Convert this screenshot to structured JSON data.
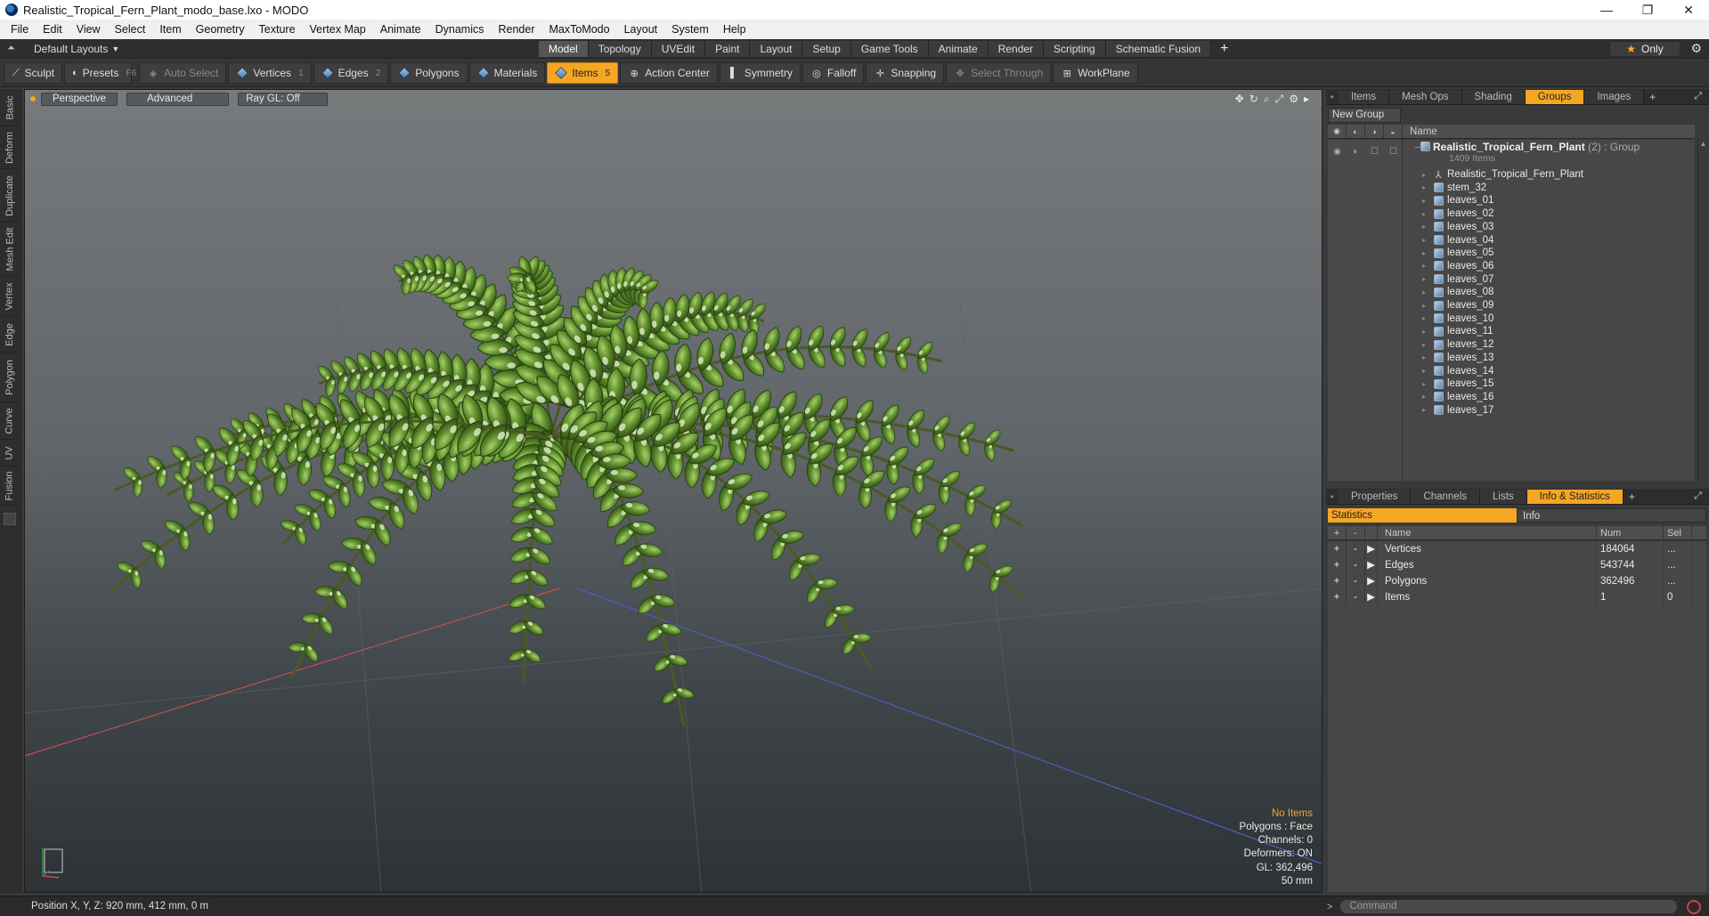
{
  "window": {
    "title": "Realistic_Tropical_Fern_Plant_modo_base.lxo - MODO",
    "controls": [
      "—",
      "❐",
      "✕"
    ]
  },
  "menu": [
    "File",
    "Edit",
    "View",
    "Select",
    "Item",
    "Geometry",
    "Texture",
    "Vertex Map",
    "Animate",
    "Dynamics",
    "Render",
    "MaxToModo",
    "Layout",
    "System",
    "Help"
  ],
  "layoutbar": {
    "layout_name": "Default Layouts",
    "tabs": [
      "Model",
      "Topology",
      "UVEdit",
      "Paint",
      "Layout",
      "Setup",
      "Game Tools",
      "Animate",
      "Render",
      "Scripting",
      "Schematic Fusion"
    ],
    "active_tab": "Model",
    "only_label": "Only"
  },
  "toolbar": {
    "sculpt": "Sculpt",
    "presets": "Presets",
    "presets_key": "F6",
    "auto_select": "Auto Select",
    "vertices": "Vertices",
    "vertices_key": "1",
    "edges": "Edges",
    "edges_key": "2",
    "polygons": "Polygons",
    "materials": "Materials",
    "items": "Items",
    "items_key": "5",
    "action_center": "Action Center",
    "symmetry": "Symmetry",
    "falloff": "Falloff",
    "snapping": "Snapping",
    "select_through": "Select Through",
    "workplane": "WorkPlane"
  },
  "left_tabs": [
    "Basic",
    "Deform",
    "Duplicate",
    "Mesh Edit",
    "Vertex",
    "Edge",
    "Polygon",
    "Curve",
    "UV",
    "Fusion"
  ],
  "viewport": {
    "view": "Perspective",
    "shading": "Advanced",
    "raygl": "Ray GL: Off",
    "info": {
      "selection": "No Items",
      "polygons": "Polygons : Face",
      "channels": "Channels: 0",
      "deformers": "Deformers: ON",
      "gl": "GL: 362,496",
      "scale": "50 mm"
    }
  },
  "groups_panel": {
    "tabs": [
      "Items",
      "Mesh Ops",
      "Shading",
      "Groups",
      "Images"
    ],
    "active_tab": "Groups",
    "new_group": "New Group",
    "col_name": "Name",
    "group": {
      "name": "Realistic_Tropical_Fern_Plant",
      "suffix": "(2) : Group",
      "count": "1409 Items"
    },
    "items": [
      {
        "name": "Realistic_Tropical_Fern_Plant",
        "icon": "locator-icon"
      },
      {
        "name": "stem_32",
        "icon": "mesh-icon"
      },
      {
        "name": "leaves_01",
        "icon": "mesh-icon"
      },
      {
        "name": "leaves_02",
        "icon": "mesh-icon"
      },
      {
        "name": "leaves_03",
        "icon": "mesh-icon"
      },
      {
        "name": "leaves_04",
        "icon": "mesh-icon"
      },
      {
        "name": "leaves_05",
        "icon": "mesh-icon"
      },
      {
        "name": "leaves_06",
        "icon": "mesh-icon"
      },
      {
        "name": "leaves_07",
        "icon": "mesh-icon"
      },
      {
        "name": "leaves_08",
        "icon": "mesh-icon"
      },
      {
        "name": "leaves_09",
        "icon": "mesh-icon"
      },
      {
        "name": "leaves_10",
        "icon": "mesh-icon"
      },
      {
        "name": "leaves_11",
        "icon": "mesh-icon"
      },
      {
        "name": "leaves_12",
        "icon": "mesh-icon"
      },
      {
        "name": "leaves_13",
        "icon": "mesh-icon"
      },
      {
        "name": "leaves_14",
        "icon": "mesh-icon"
      },
      {
        "name": "leaves_15",
        "icon": "mesh-icon"
      },
      {
        "name": "leaves_16",
        "icon": "mesh-icon"
      },
      {
        "name": "leaves_17",
        "icon": "mesh-icon"
      }
    ]
  },
  "props_panel": {
    "tabs": [
      "Properties",
      "Channels",
      "Lists",
      "Info & Statistics"
    ],
    "active_tab": "Info & Statistics",
    "sub_tabs": [
      "Statistics",
      "Info"
    ],
    "columns": {
      "name": "Name",
      "num": "Num",
      "sel": "Sel"
    },
    "rows": [
      {
        "name": "Vertices",
        "num": "184064",
        "sel": "..."
      },
      {
        "name": "Edges",
        "num": "543744",
        "sel": "..."
      },
      {
        "name": "Polygons",
        "num": "362496",
        "sel": "..."
      },
      {
        "name": "Items",
        "num": "1",
        "sel": "0"
      }
    ]
  },
  "statusbar": {
    "position": "Position X, Y, Z:  920 mm, 412 mm, 0 m",
    "command_placeholder": "Command"
  },
  "colors": {
    "accent": "#f5a623",
    "fern_green": "#5f8f2e",
    "viewport_top": "#777a7b"
  }
}
